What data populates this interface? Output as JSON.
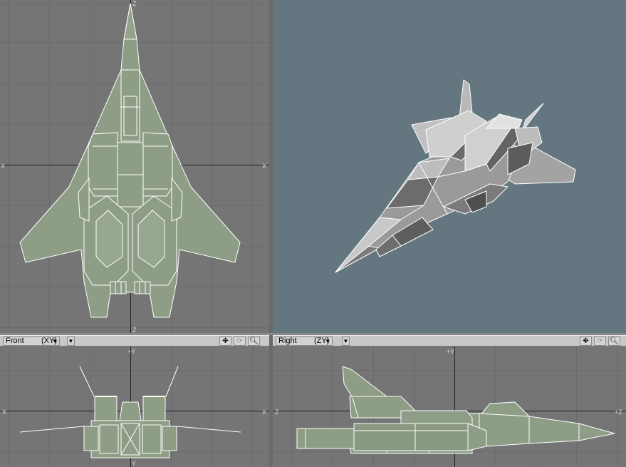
{
  "viewports": {
    "top_left": {
      "axis_top": "Z",
      "axis_bottom": "Z",
      "axis_left": "X",
      "axis_right": "X"
    },
    "perspective": {},
    "front": {
      "view_label": "Front",
      "axis_label": "(XY)",
      "axis_top": "+Y",
      "axis_left": "X",
      "axis_right": "X",
      "axis_bottom": "Y"
    },
    "right": {
      "view_label": "Right",
      "axis_label": "(ZY)",
      "axis_top": "+Y",
      "axis_left": "Z",
      "axis_right": "+Z"
    }
  },
  "icons": [
    "dropdown-arrow-icon",
    "move-icon",
    "rotate-icon",
    "zoom-icon"
  ],
  "colors": {
    "viewport_bg": "#757575",
    "perspective_bg": "#647780",
    "grid_line": "#6c6c6c",
    "axis_line": "#202020",
    "mesh_fill": "#8e9e86",
    "mesh_edge": "#ffffff"
  }
}
